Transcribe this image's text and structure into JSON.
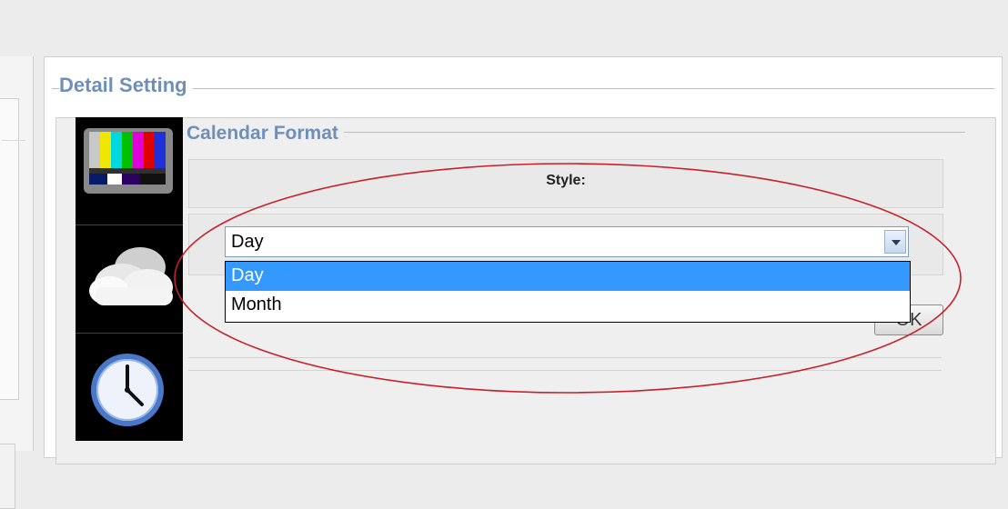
{
  "detail_setting": {
    "title": "Detail Setting"
  },
  "calendar_format": {
    "title": "Calendar Format",
    "style_label": "Style:",
    "select": {
      "value": "Day",
      "options": [
        "Day",
        "Month"
      ]
    },
    "ok_label": "OK"
  },
  "icons": [
    "tv-color-bars-icon",
    "weather-clouds-icon",
    "clock-icon"
  ],
  "colors": {
    "title_blue": "#6f8fb8",
    "highlight": "#3399ff",
    "annotation": "#c8202a"
  }
}
